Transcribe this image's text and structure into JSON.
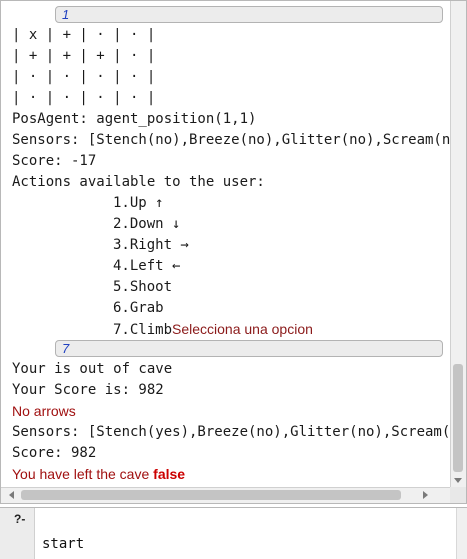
{
  "console": {
    "query1": "1",
    "board": [
      "| x | + | · | · |",
      "| + | + | + | · |",
      "| · | · | · | · |",
      "| · | · | · | · |"
    ],
    "pos_agent": "PosAgent: agent_position(1,1)",
    "sensors1": "Sensors: [Stench(no),Breeze(no),Glitter(no),Scream(no",
    "score1": "Score: -17",
    "actions_header": "Actions available to the user:",
    "actions": [
      "1.Up ↑",
      "2.Down ↓",
      "3.Right →",
      "4.Left ←",
      "5.Shoot",
      "6.Grab",
      "7.Climb"
    ],
    "select_prompt": "Selecciona una opcion",
    "query2": "7",
    "out_of_cave": "Your is out of cave",
    "your_score": "Your Score is: 982",
    "no_arrows": "No arrows",
    "sensors2": "Sensors: [Stench(yes),Breeze(no),Glitter(no),Scream(n",
    "score2": "Score: 982",
    "left_cave_label": "You have left the cave ",
    "left_cave_value": "false"
  },
  "input": {
    "prompt": "?-",
    "text": "start"
  }
}
